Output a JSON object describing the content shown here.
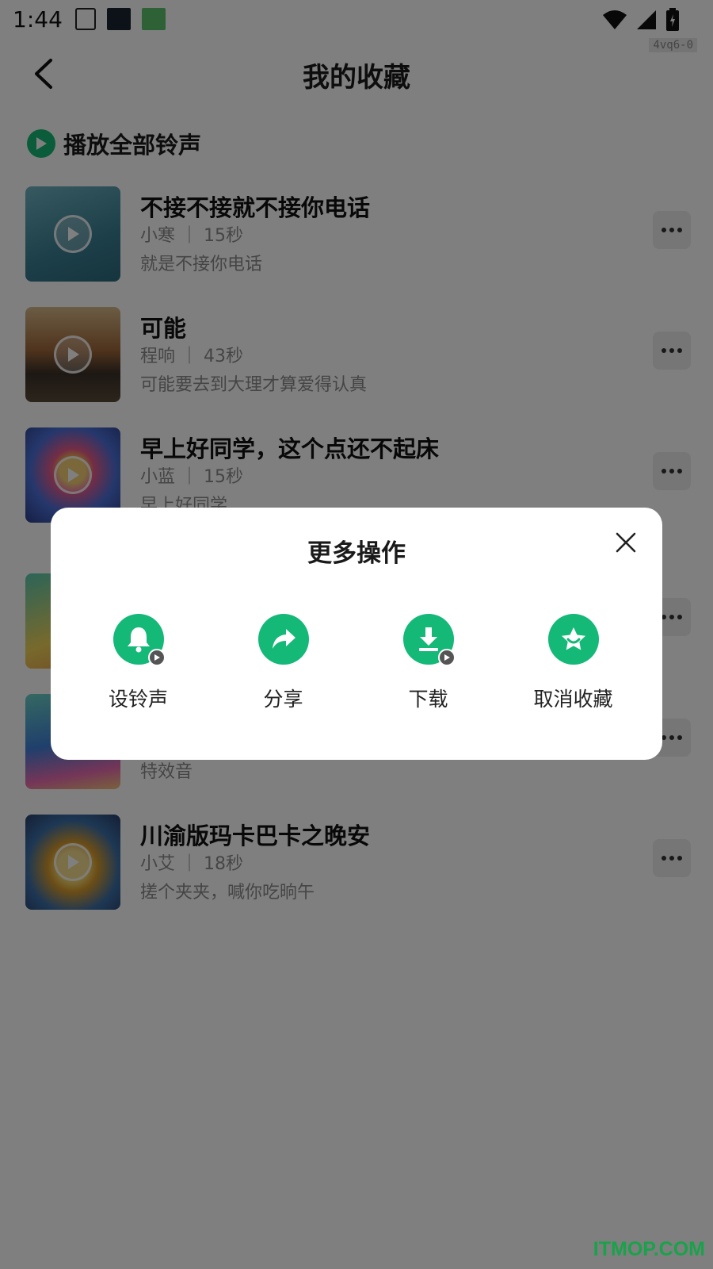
{
  "status_bar": {
    "time": "1:44",
    "version_tag": "4vq6-0",
    "icons": [
      "sim-card-icon",
      "clock-app-icon",
      "store-app-icon",
      "wifi-icon",
      "signal-icon",
      "battery-charging-icon"
    ]
  },
  "header": {
    "title": "我的收藏",
    "back_icon": "chevron-left-icon"
  },
  "play_all": {
    "label": "播放全部铃声",
    "icon": "play-circle-icon"
  },
  "items": [
    {
      "title": "不接不接就不接你电话",
      "meta": "小寒 ｜ 15秒",
      "desc": "就是不接你电话"
    },
    {
      "title": "可能",
      "meta": "程响 ｜ 43秒",
      "desc": "可能要去到大理才算爱得认真"
    },
    {
      "title": "早上好同学，这个点还不起床",
      "meta": "小蓝 ｜ 15秒",
      "desc": "早上好同学"
    },
    {
      "title": "",
      "meta": "",
      "desc": ""
    },
    {
      "title": "",
      "meta": "",
      "desc": "特效音"
    },
    {
      "title": "川渝版玛卡巴卡之晚安",
      "meta": "小艾 ｜ 18秒",
      "desc": "搓个夹夹，喊你吃晌午"
    }
  ],
  "dialog": {
    "title": "更多操作",
    "close_icon": "close-icon",
    "actions": [
      {
        "label": "设铃声",
        "icon": "bell-icon"
      },
      {
        "label": "分享",
        "icon": "share-arrow-icon"
      },
      {
        "label": "下载",
        "icon": "download-icon"
      },
      {
        "label": "取消收藏",
        "icon": "star-badge-icon"
      }
    ]
  },
  "watermark": "ITMOP.COM",
  "colors": {
    "accent": "#14b877",
    "overlay": "rgba(0,0,0,0.5)",
    "watermark": "#18a34a"
  }
}
